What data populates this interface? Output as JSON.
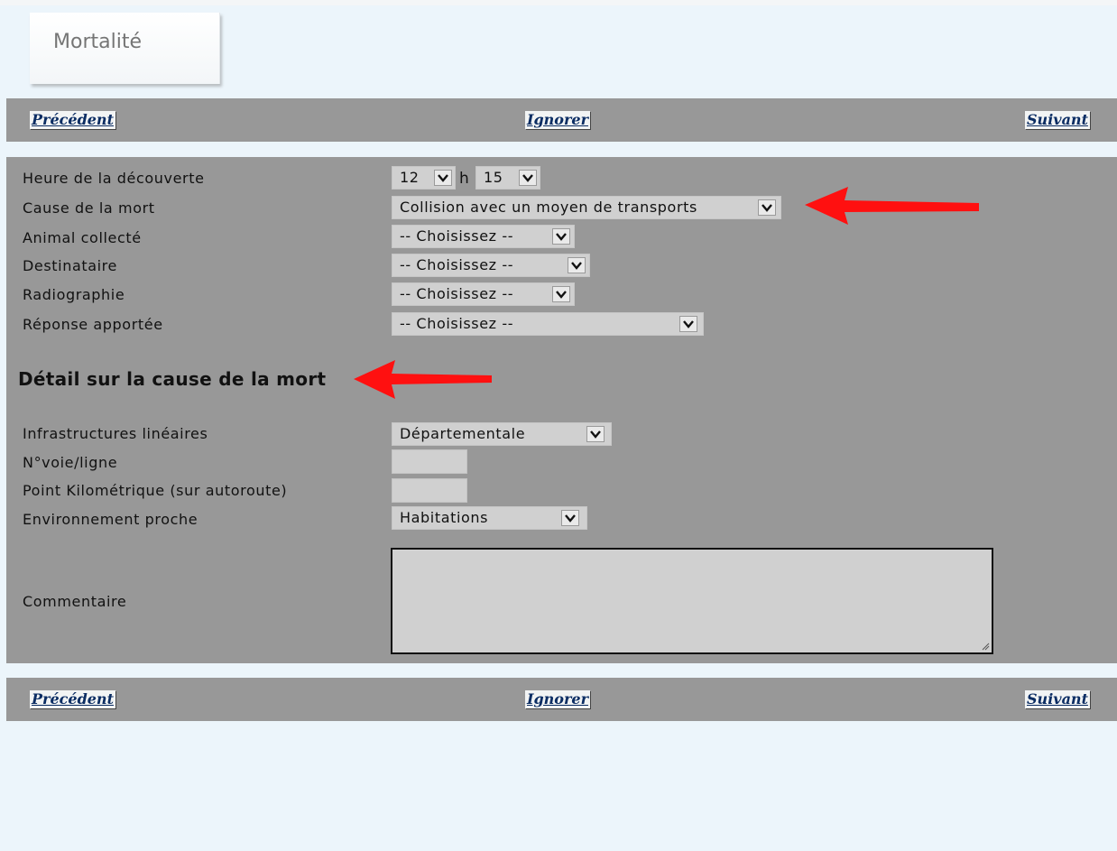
{
  "page": {
    "title": "Mortalité"
  },
  "nav": {
    "prev": "Précédent",
    "skip": "Ignorer",
    "next": "Suivant"
  },
  "form": {
    "heure": {
      "label": "Heure de la découverte",
      "hours": "12",
      "sep": "h",
      "minutes": "15"
    },
    "cause": {
      "label": "Cause de la mort",
      "value": "Collision avec un moyen de transports"
    },
    "collecte": {
      "label": "Animal collecté",
      "value": "-- Choisissez --"
    },
    "destinataire": {
      "label": "Destinataire",
      "value": "-- Choisissez --"
    },
    "radiographie": {
      "label": "Radiographie",
      "value": "-- Choisissez --"
    },
    "reponse": {
      "label": "Réponse apportée",
      "value": "-- Choisissez --"
    },
    "detail_heading": "Détail sur la cause de la mort",
    "infrastructures": {
      "label": "Infrastructures linéaires",
      "value": "Départementale"
    },
    "voie": {
      "label": "N°voie/ligne",
      "value": ""
    },
    "pk": {
      "label": "Point Kilométrique (sur autoroute)",
      "value": ""
    },
    "environnement": {
      "label": "Environnement proche",
      "value": "Habitations"
    },
    "commentaire": {
      "label": "Commentaire",
      "value": ""
    }
  },
  "colors": {
    "panel": "#989898",
    "background": "#ecf5fb",
    "field": "#d0d0d0",
    "nav_text": "#0b2d63",
    "annotation_arrow": "#ff1010"
  }
}
